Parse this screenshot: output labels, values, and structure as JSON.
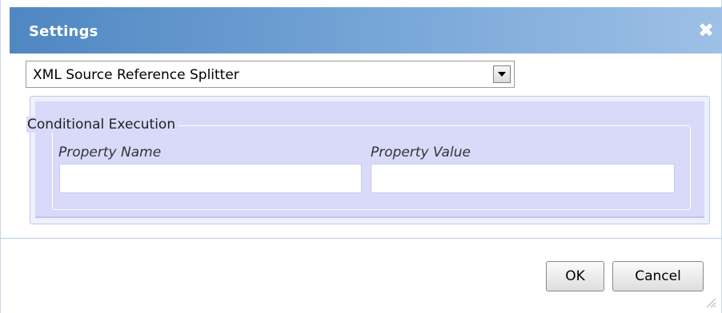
{
  "dialog": {
    "title": "Settings",
    "close_glyph": "✖"
  },
  "component_select": {
    "selected": "XML Source Reference Splitter"
  },
  "conditional_execution": {
    "legend": "Conditional Execution",
    "property_name_label": "Property Name",
    "property_value_label": "Property Value",
    "property_name_value": "",
    "property_value_value": ""
  },
  "footer": {
    "ok_label": "OK",
    "cancel_label": "Cancel"
  },
  "icons": {
    "close": "close-icon",
    "dropdown": "chevron-down-icon",
    "resize": "resize-grip-icon"
  },
  "colors": {
    "titlebar_start": "#4f87c2",
    "titlebar_end": "#9ec0e6",
    "panel_fill": "#d9dafa"
  }
}
